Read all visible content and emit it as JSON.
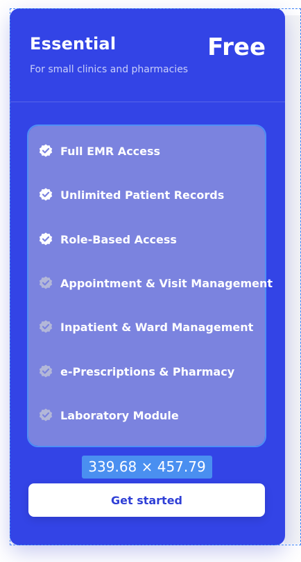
{
  "plan": {
    "name": "Essential",
    "price": "Free",
    "description": "For small clinics and pharmacies"
  },
  "features": [
    {
      "label": "Full EMR Access",
      "included": true
    },
    {
      "label": "Unlimited Patient Records",
      "included": true
    },
    {
      "label": "Role-Based Access",
      "included": true
    },
    {
      "label": "Appointment & Visit Management",
      "included": false
    },
    {
      "label": "Inpatient & Ward Management",
      "included": false
    },
    {
      "label": "e-Prescriptions & Pharmacy",
      "included": false
    },
    {
      "label": "Laboratory Module",
      "included": false
    }
  ],
  "selection": {
    "size_label": "339.68 × 457.79"
  },
  "cta": {
    "label": "Get started"
  },
  "colors": {
    "card": "#3344e6",
    "features_box": "#7b83df",
    "included_badge": "#ffffff",
    "excluded_badge": "#b3b7d8",
    "selection": "#4a8ff0"
  }
}
